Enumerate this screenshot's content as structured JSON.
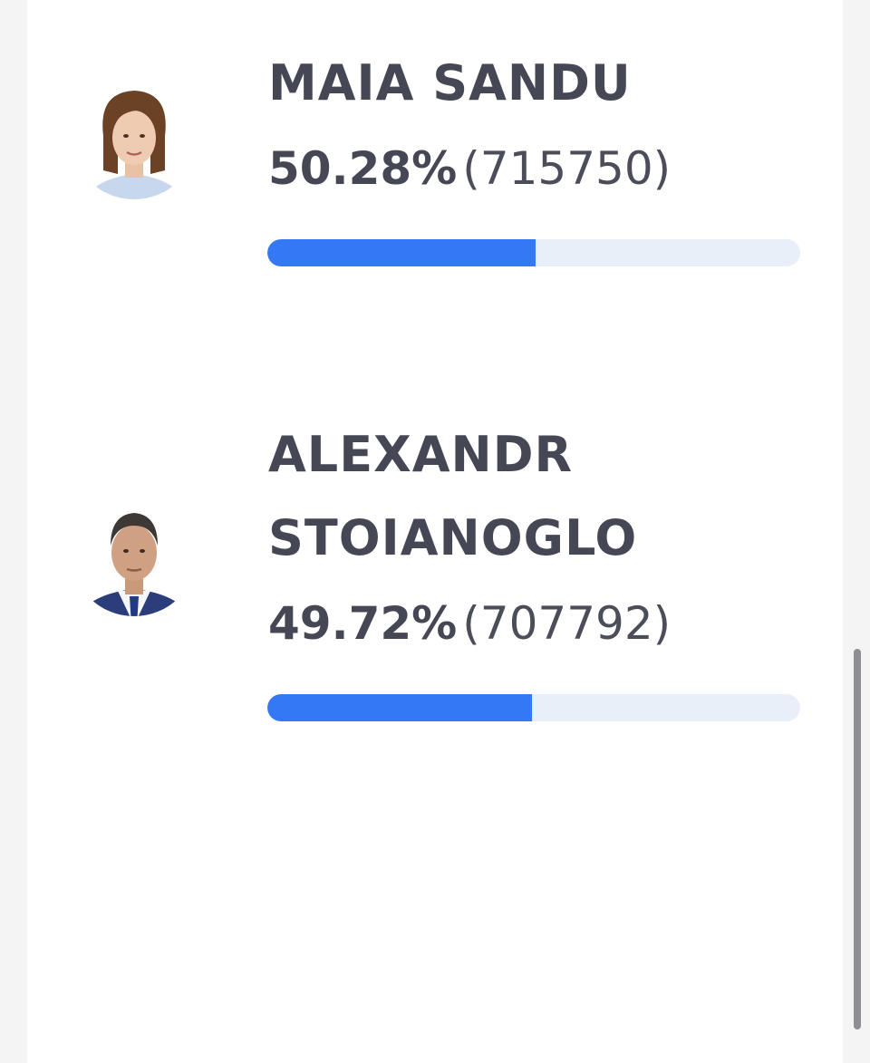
{
  "candidates": [
    {
      "name": "MAIA SANDU",
      "percent_text": "50.28%",
      "votes_text": "(715750)",
      "share": 0.5028,
      "bar_color": "#3478f6",
      "avatar_icon": "portrait-woman"
    },
    {
      "name": "ALEXANDR STOIANOGLO",
      "percent_text": "49.72%",
      "votes_text": "(707792)",
      "share": 0.4972,
      "bar_color": "#3478f6",
      "avatar_icon": "portrait-man"
    }
  ],
  "colors": {
    "text": "#454854",
    "bar_fill": "#3478f6",
    "bar_track": "#e9eff8",
    "page_background": "#f4f4f5",
    "card_background": "#ffffff"
  }
}
